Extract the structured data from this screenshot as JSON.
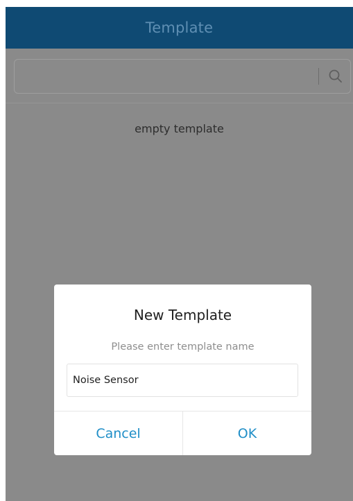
{
  "header": {
    "title": "Template"
  },
  "search": {
    "value": "",
    "placeholder": "",
    "icon": "search-icon"
  },
  "list": {
    "empty_message": "empty template"
  },
  "dialog": {
    "title": "New Template",
    "subtitle": "Please enter template name",
    "input_value": "Noise Sensor",
    "cancel_label": "Cancel",
    "ok_label": "OK"
  },
  "colors": {
    "header_background": "#0f4a73",
    "header_text": "#5f8fb3",
    "overlay_background": "#8a8a8a",
    "accent": "#1f8ec7"
  }
}
